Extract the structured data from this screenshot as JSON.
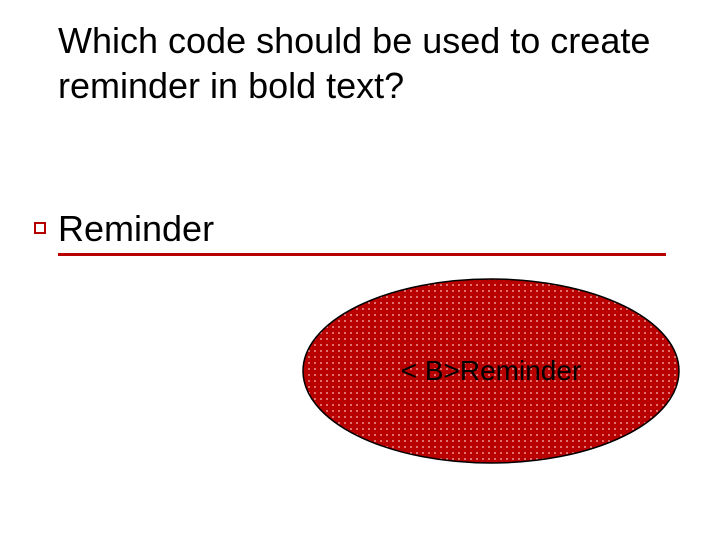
{
  "title": "Which code should be used to create reminder in bold text?",
  "bullet": "Reminder",
  "oval": {
    "text": "< B>Reminder",
    "fill": "#B80000",
    "stroke": "#000000",
    "dot": "#FFC0C0"
  }
}
